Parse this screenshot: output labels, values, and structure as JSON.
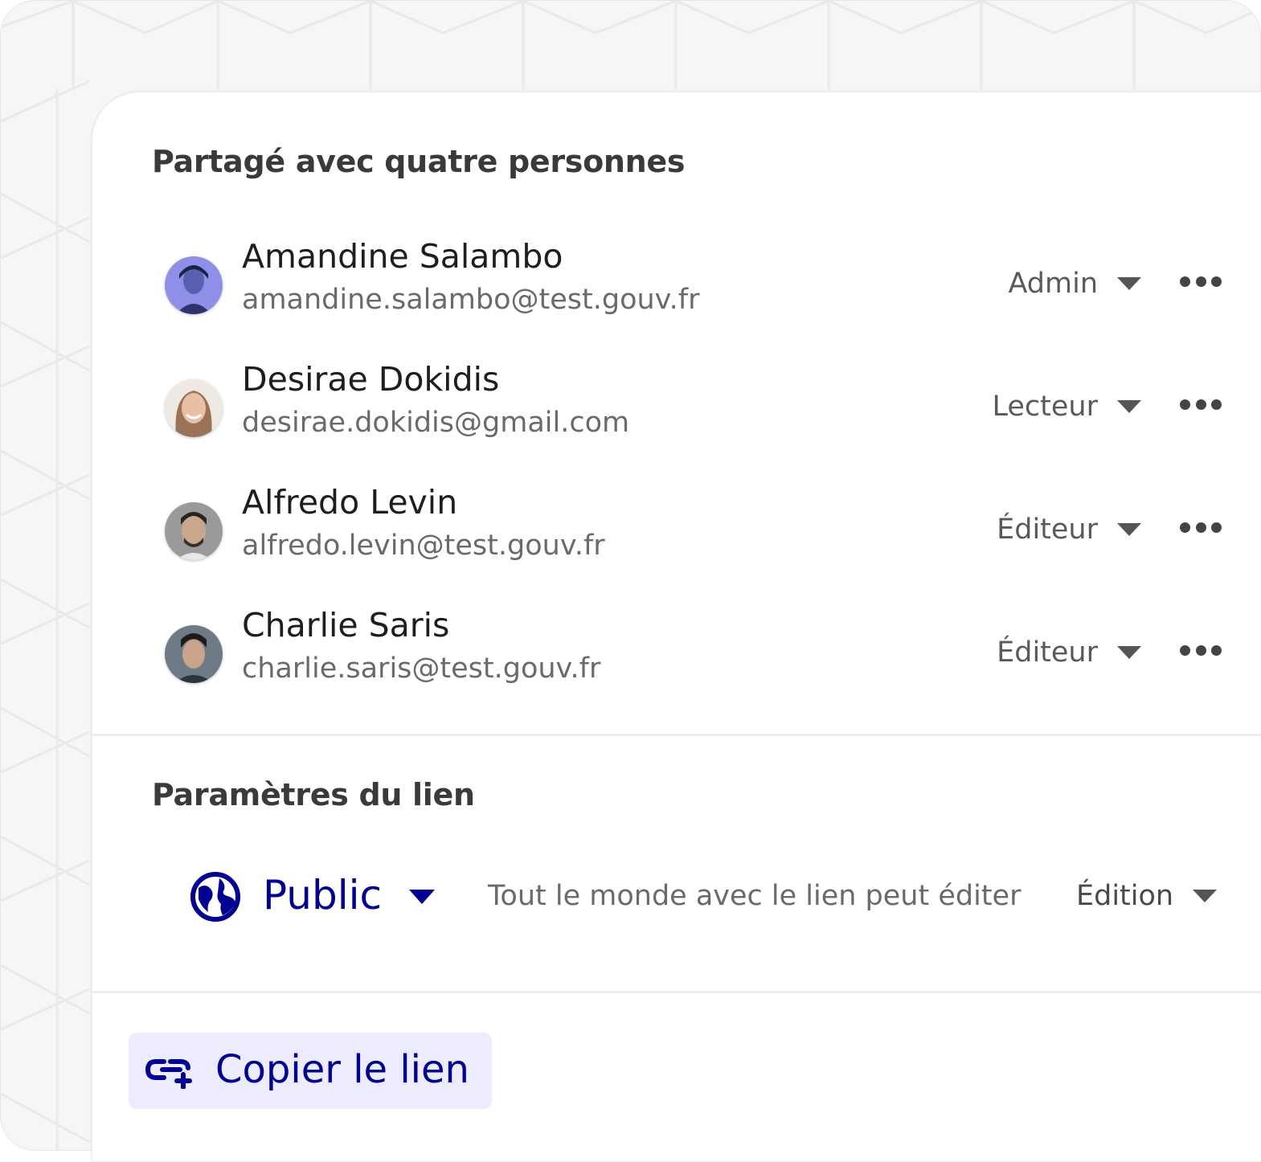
{
  "shared_section": {
    "title": "Partagé avec quatre personnes"
  },
  "members": [
    {
      "name": "Amandine Salambo",
      "email": "amandine.salambo@test.gouv.fr",
      "role": "Admin",
      "avatar": "avatar-photo"
    },
    {
      "name": "Desirae Dokidis",
      "email": "desirae.dokidis@gmail.com",
      "role": "Lecteur",
      "avatar": "avatar-photo"
    },
    {
      "name": "Alfredo Levin",
      "email": "alfredo.levin@test.gouv.fr",
      "role": "Éditeur",
      "avatar": "avatar-photo"
    },
    {
      "name": "Charlie Saris",
      "email": "charlie.saris@test.gouv.fr",
      "role": "Éditeur",
      "avatar": "avatar-photo"
    }
  ],
  "link_section": {
    "title": "Paramètres du lien",
    "access": "Public",
    "access_icon": "globe-icon",
    "description": "Tout le monde avec le lien peut éditer",
    "permission": "Édition"
  },
  "copy_button": {
    "label": "Copier le lien",
    "icon": "link-add-icon"
  },
  "colors": {
    "accent": "#000091",
    "accent_bg": "#ececfe",
    "text_primary": "#1e1e1e",
    "text_secondary": "#6a6a6a"
  }
}
